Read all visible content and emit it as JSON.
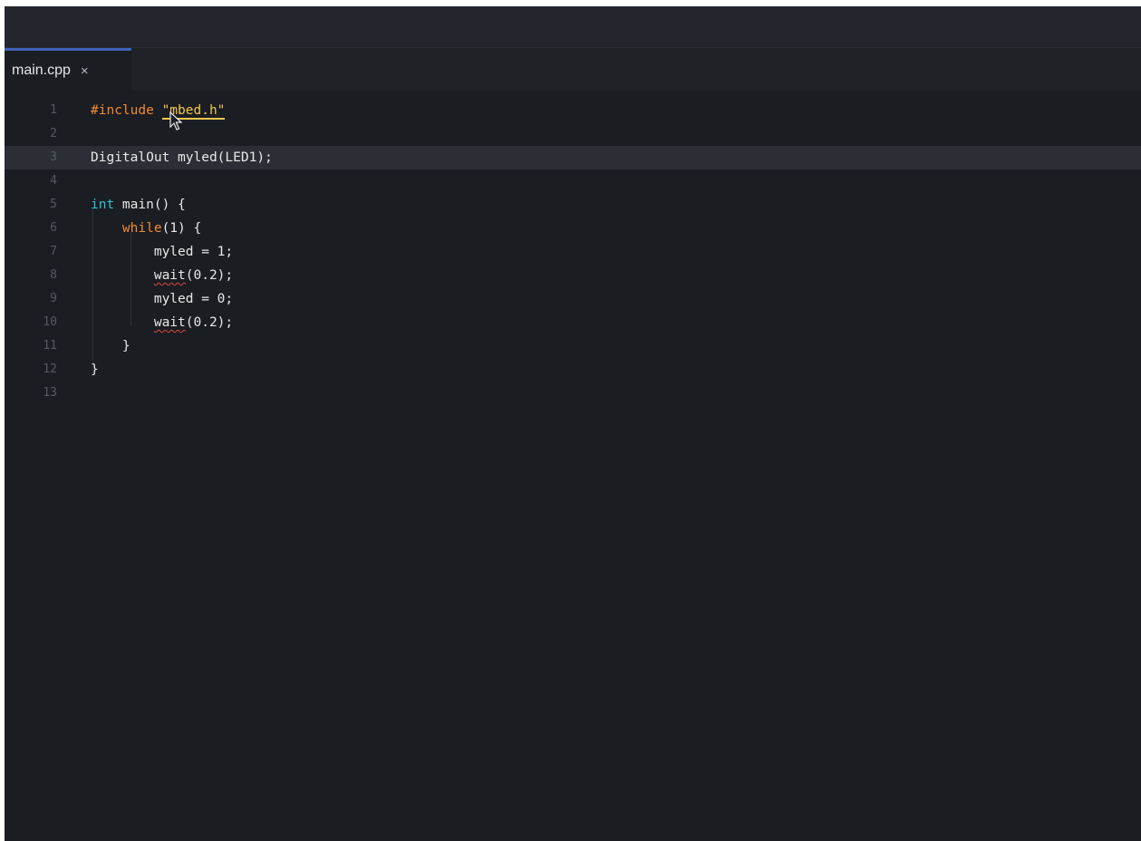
{
  "tab": {
    "filename": "main.cpp",
    "close_glyph": "×"
  },
  "editor": {
    "current_line": 3,
    "lines": [
      {
        "number": "1",
        "tokens": [
          {
            "text": "#include ",
            "cls": "kw-pre"
          },
          {
            "text": "\"mbed.h\"",
            "cls": "str"
          }
        ]
      },
      {
        "number": "2",
        "tokens": []
      },
      {
        "number": "3",
        "tokens": [
          {
            "text": "DigitalOut myled(LED1);",
            "cls": ""
          }
        ]
      },
      {
        "number": "4",
        "tokens": []
      },
      {
        "number": "5",
        "tokens": [
          {
            "text": "int",
            "cls": "kw-type"
          },
          {
            "text": " main() {",
            "cls": ""
          }
        ]
      },
      {
        "number": "6",
        "tokens": [
          {
            "text": "    "
          },
          {
            "text": "while",
            "cls": "kw-ctrl"
          },
          {
            "text": "(1) {",
            "cls": ""
          }
        ]
      },
      {
        "number": "7",
        "tokens": [
          {
            "text": "        myled = 1;",
            "cls": ""
          }
        ]
      },
      {
        "number": "8",
        "tokens": [
          {
            "text": "        "
          },
          {
            "text": "wait",
            "cls": "squiggle"
          },
          {
            "text": "(0.2);",
            "cls": ""
          }
        ]
      },
      {
        "number": "9",
        "tokens": [
          {
            "text": "        myled = 0;",
            "cls": ""
          }
        ]
      },
      {
        "number": "10",
        "tokens": [
          {
            "text": "        "
          },
          {
            "text": "wait",
            "cls": "squiggle"
          },
          {
            "text": "(0.2);",
            "cls": ""
          }
        ]
      },
      {
        "number": "11",
        "tokens": [
          {
            "text": "    }",
            "cls": ""
          }
        ]
      },
      {
        "number": "12",
        "tokens": [
          {
            "text": "}",
            "cls": ""
          }
        ]
      },
      {
        "number": "13",
        "tokens": []
      }
    ]
  },
  "colors": {
    "background": "#1a1d22",
    "preprocessor": "#f28b30",
    "type_keyword": "#2ec4cf",
    "string": "#f2c84b",
    "error_squiggle": "#e0463e",
    "tab_accent": "#4060b8"
  }
}
